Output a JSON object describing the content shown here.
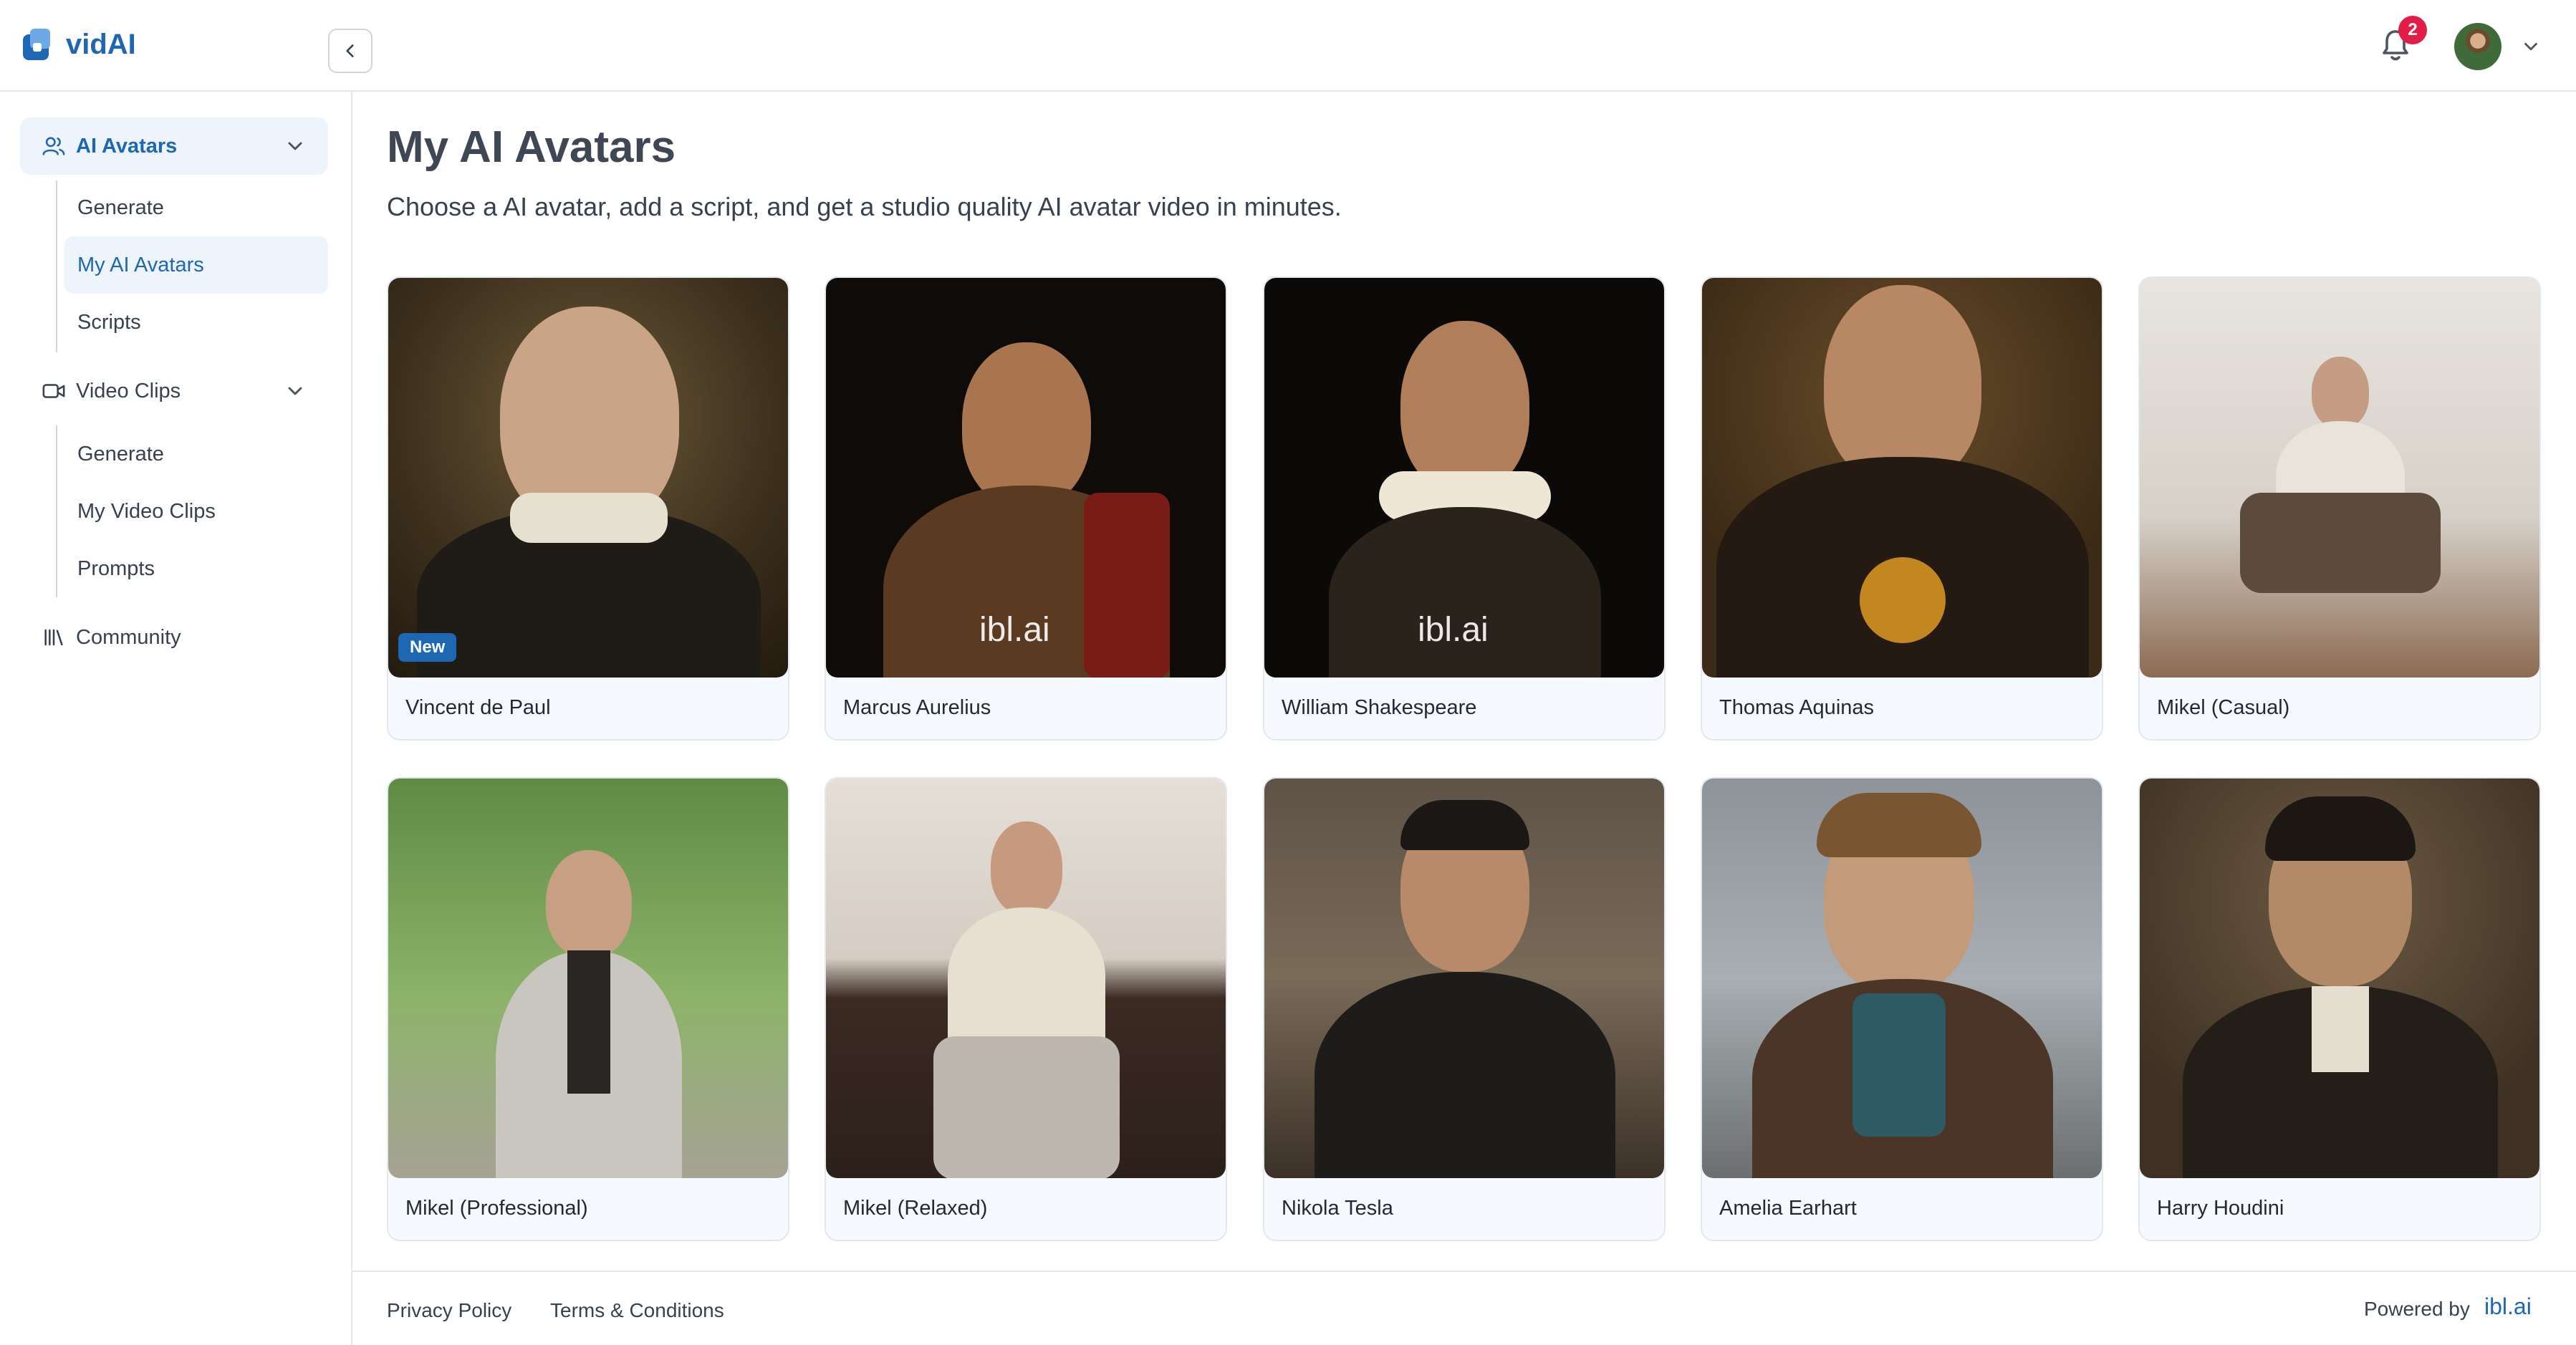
{
  "app": {
    "brand": "vidAI",
    "notifications_count": "2"
  },
  "sidebar": {
    "groups": [
      {
        "label": "AI Avatars",
        "icon": "users-icon",
        "items": [
          "Generate",
          "My AI Avatars",
          "Scripts"
        ]
      },
      {
        "label": "Video Clips",
        "icon": "video-icon",
        "items": [
          "Generate",
          "My Video Clips",
          "Prompts"
        ]
      },
      {
        "label": "Community",
        "icon": "library-icon",
        "items": []
      }
    ],
    "active_item": "My AI Avatars"
  },
  "main": {
    "title": "My AI Avatars",
    "subtitle": "Choose a AI avatar, add a script, and get a studio quality AI avatar video in minutes.",
    "avatars": [
      {
        "name": "Vincent de Paul",
        "badge": "New"
      },
      {
        "name": "Marcus Aurelius",
        "watermark": "ibl.ai"
      },
      {
        "name": "William Shakespeare",
        "watermark": "ibl.ai"
      },
      {
        "name": "Thomas Aquinas"
      },
      {
        "name": "Mikel (Casual)"
      },
      {
        "name": "Mikel (Professional)"
      },
      {
        "name": "Mikel (Relaxed)"
      },
      {
        "name": "Nikola Tesla"
      },
      {
        "name": "Amelia Earhart"
      },
      {
        "name": "Harry Houdini"
      }
    ]
  },
  "footer": {
    "privacy": "Privacy Policy",
    "terms": "Terms & Conditions",
    "powered_by": "Powered by",
    "powered_logo": "ibl.ai"
  }
}
